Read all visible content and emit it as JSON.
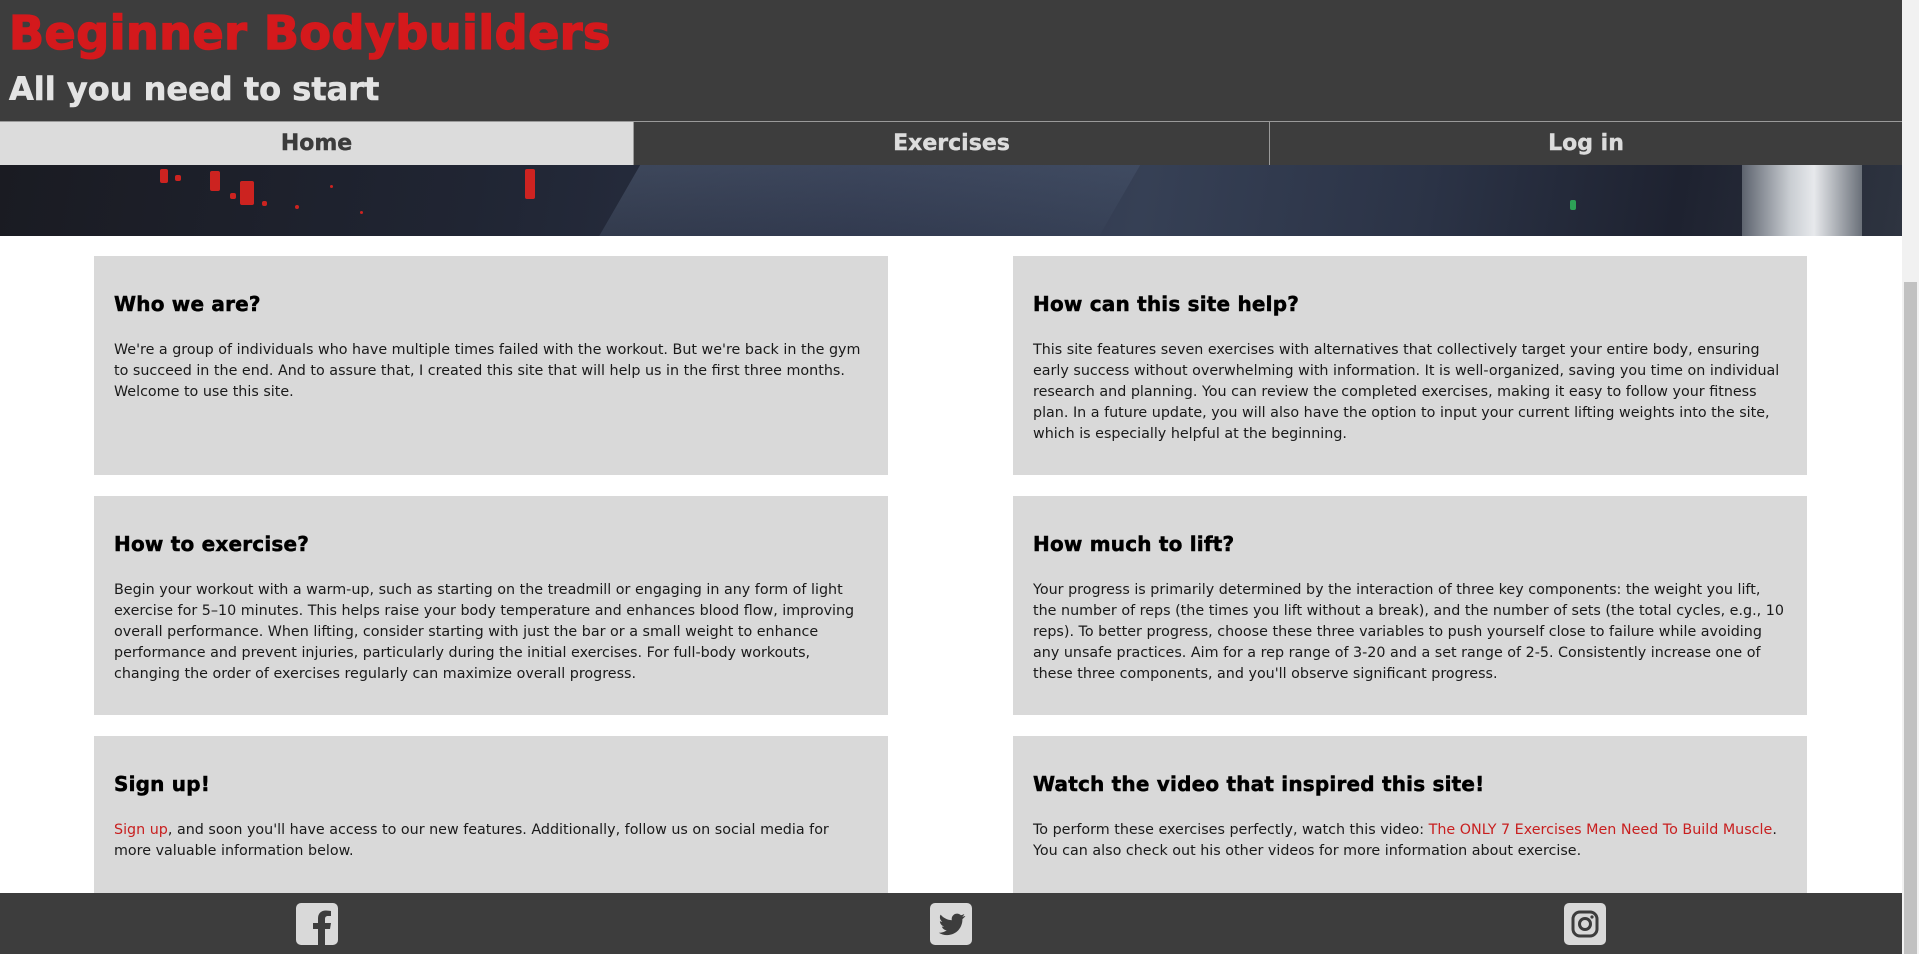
{
  "header": {
    "title": "Beginner Bodybuilders",
    "tagline": "All you need to start"
  },
  "nav": {
    "items": [
      {
        "label": "Home",
        "active": true
      },
      {
        "label": "Exercises",
        "active": false
      },
      {
        "label": "Log in",
        "active": false
      }
    ]
  },
  "cards": {
    "who": {
      "title": "Who we are?",
      "text": "We're a group of individuals who have multiple times failed with the workout. But we're back in the gym to succeed in the end. And to assure that, I created this site that will help us in the first three months. Welcome to use this site."
    },
    "help": {
      "title": "How can this site help?",
      "text": "This site features seven exercises with alternatives that collectively target your entire body, ensuring early success without overwhelming with information. It is well-organized, saving you time on individual research and planning. You can review the completed exercises, making it easy to follow your fitness plan. In a future update, you will also have the option to input your current lifting weights into the site, which is especially helpful at the beginning."
    },
    "exercise": {
      "title": "How to exercise?",
      "text": "Begin your workout with a warm-up, such as starting on the treadmill or engaging in any form of light exercise for 5–10 minutes. This helps raise your body temperature and enhances blood flow, improving overall performance. When lifting, consider starting with just the bar or a small weight to enhance performance and prevent injuries, particularly during the initial exercises. For full-body workouts, changing the order of exercises regularly can maximize overall progress."
    },
    "lift": {
      "title": "How much to lift?",
      "text": "Your progress is primarily determined by the interaction of three key components: the weight you lift, the number of reps (the times you lift without a break), and the number of sets (the total cycles, e.g., 10 reps). To better progress, choose these three variables to push yourself close to failure while avoiding any unsafe practices. Aim for a rep range of 3-20 and a set range of 2-5. Consistently increase one of these three components, and you'll observe significant progress."
    },
    "signup": {
      "title": "Sign up!",
      "link": "Sign up",
      "text": ", and soon you'll have access to our new features. Additionally, follow us on social media for more valuable information below."
    },
    "video": {
      "title": "Watch the video that inspired this site!",
      "text_before": "To perform these exercises perfectly, watch this video: ",
      "link": "The ONLY 7 Exercises Men Need To Build Muscle",
      "text_after": ". You can also check out his other videos for more information about exercise."
    }
  },
  "footer": {
    "icons": [
      "facebook-icon",
      "twitter-icon",
      "instagram-icon"
    ]
  },
  "colors": {
    "brand_red": "#d4191c",
    "header_bg": "#3d3d3d",
    "card_bg": "#d9d9d9",
    "link": "#c81f1f"
  }
}
